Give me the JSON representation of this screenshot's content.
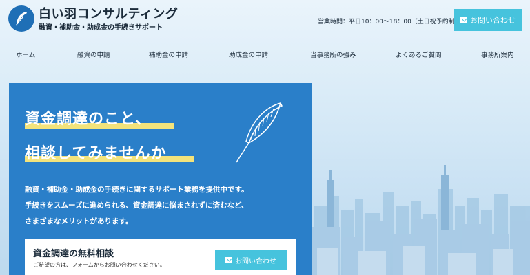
{
  "header": {
    "brand_title": "白い羽コンサルティング",
    "brand_subtitle": "融資・補助金・助成金の手続きサポート",
    "hours": "営業時間：平日10：00〜18：00（土日祝予約制）",
    "contact_button": "お問い合わせ"
  },
  "nav": {
    "items": [
      "ホーム",
      "融資の申請",
      "補助金の申請",
      "助成金の申請",
      "当事務所の強み",
      "よくあるご質問",
      "事務所案内"
    ]
  },
  "hero": {
    "headline_line1": "資金調達のこと、",
    "headline_line2": "相談してみませんか",
    "desc_line1": "融資・補助金・助成金の手続きに関するサポート業務を提供中です。",
    "desc_line2": "手続きをスムーズに進められる、資金調達に悩まされずに済むなど、",
    "desc_line3": "さまざまなメリットがあります。"
  },
  "consult": {
    "title": "資金調達の無料相談",
    "note": "ご希望の方は、フォームからお問い合わせください。",
    "button": "お問い合わせ"
  },
  "colors": {
    "brand_blue": "#2a7fc9",
    "accent_cyan": "#46c3dd",
    "highlight_yellow": "#f3e37b"
  }
}
